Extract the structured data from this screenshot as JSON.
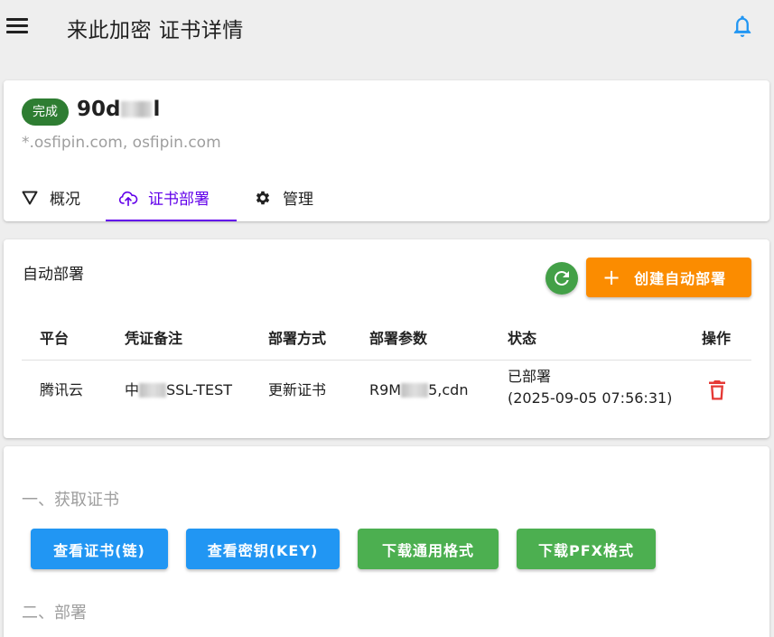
{
  "header": {
    "title": "来此加密 证书详情",
    "menu_icon": "hamburger-menu-icon",
    "bell_icon": "bell-icon",
    "bell_color": "#2196f3"
  },
  "certificate": {
    "status": "完成",
    "status_color": "#2e7d32",
    "name_prefix": "90d",
    "name_suffix": "l",
    "domains": "*.osfipin.com, osfipin.com"
  },
  "tabs": [
    {
      "label": "概况",
      "icon": "funnel-icon"
    },
    {
      "label": "证书部署",
      "icon": "cloud-upload-icon",
      "active": true
    },
    {
      "label": "管理",
      "icon": "gear-icon"
    }
  ],
  "deploy": {
    "title": "自动部署",
    "create_label": "创建自动部署",
    "columns": [
      "平台",
      "凭证备注",
      "部署方式",
      "部署参数",
      "状态",
      "操作"
    ],
    "rows": [
      {
        "platform": "腾讯云",
        "credential_prefix": "中",
        "credential_suffix": "SSL-TEST",
        "method": "更新证书",
        "params_prefix": "R9M",
        "params_suffix": "5,cdn",
        "status": "已部署",
        "status_time": "(2025-09-05 07:56:31)"
      }
    ]
  },
  "steps": {
    "step1_title": "一、获取证书",
    "step2_title": "二、部署",
    "buttons": [
      "查看证书(链)",
      "查看密钥(KEY)",
      "下载通用格式",
      "下载PFX格式"
    ]
  },
  "colors": {
    "accent": "#6200ea",
    "orange": "#fb8c00",
    "blue": "#2196f3",
    "green": "#4caf50",
    "danger": "#e53935"
  }
}
